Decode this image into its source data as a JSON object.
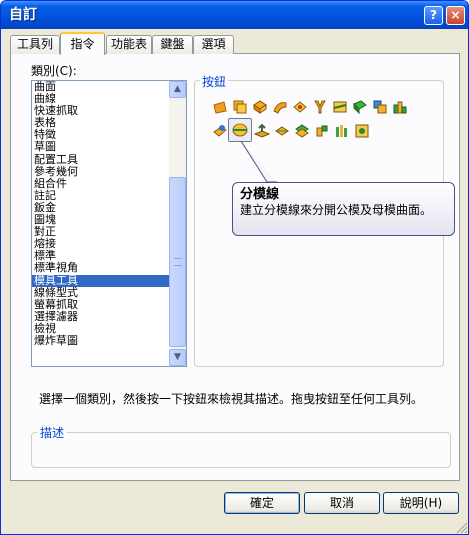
{
  "window": {
    "title": "自訂",
    "help_button": "?",
    "close_button": "×"
  },
  "tabs": [
    {
      "label": "工具列",
      "active": false
    },
    {
      "label": "指令",
      "active": true
    },
    {
      "label": "功能表",
      "active": false
    },
    {
      "label": "鍵盤",
      "active": false
    },
    {
      "label": "選項",
      "active": false
    }
  ],
  "category": {
    "label": "類別(C):",
    "items": [
      "曲面",
      "曲線",
      "快速抓取",
      "表格",
      "特徵",
      "草圖",
      "配置工具",
      "參考幾何",
      "組合件",
      "註記",
      "鈑金",
      "圖塊",
      "對正",
      "熔接",
      "標準",
      "標準視角",
      "模具工具",
      "線條型式",
      "螢幕抓取",
      "選擇濾器",
      "檢視",
      "爆炸草圖"
    ],
    "selected": "模具工具"
  },
  "buttons_group": {
    "title": "按鈕"
  },
  "tooltip": {
    "title": "分模線",
    "body": "建立分模線來分開公模及母模曲面。"
  },
  "instruction": "選擇一個類別，然後按一下按鈕來檢視其描述。拖曳按鈕至任何工具列。",
  "description_group": {
    "title": "描述"
  },
  "footer": {
    "ok": "確定",
    "cancel": "取消",
    "help": "說明(H)"
  },
  "colors": {
    "title_bar": "#0355e0",
    "selection": "#316ac5",
    "group_title": "#0046d5",
    "dialog_bg": "#ece9d8"
  }
}
